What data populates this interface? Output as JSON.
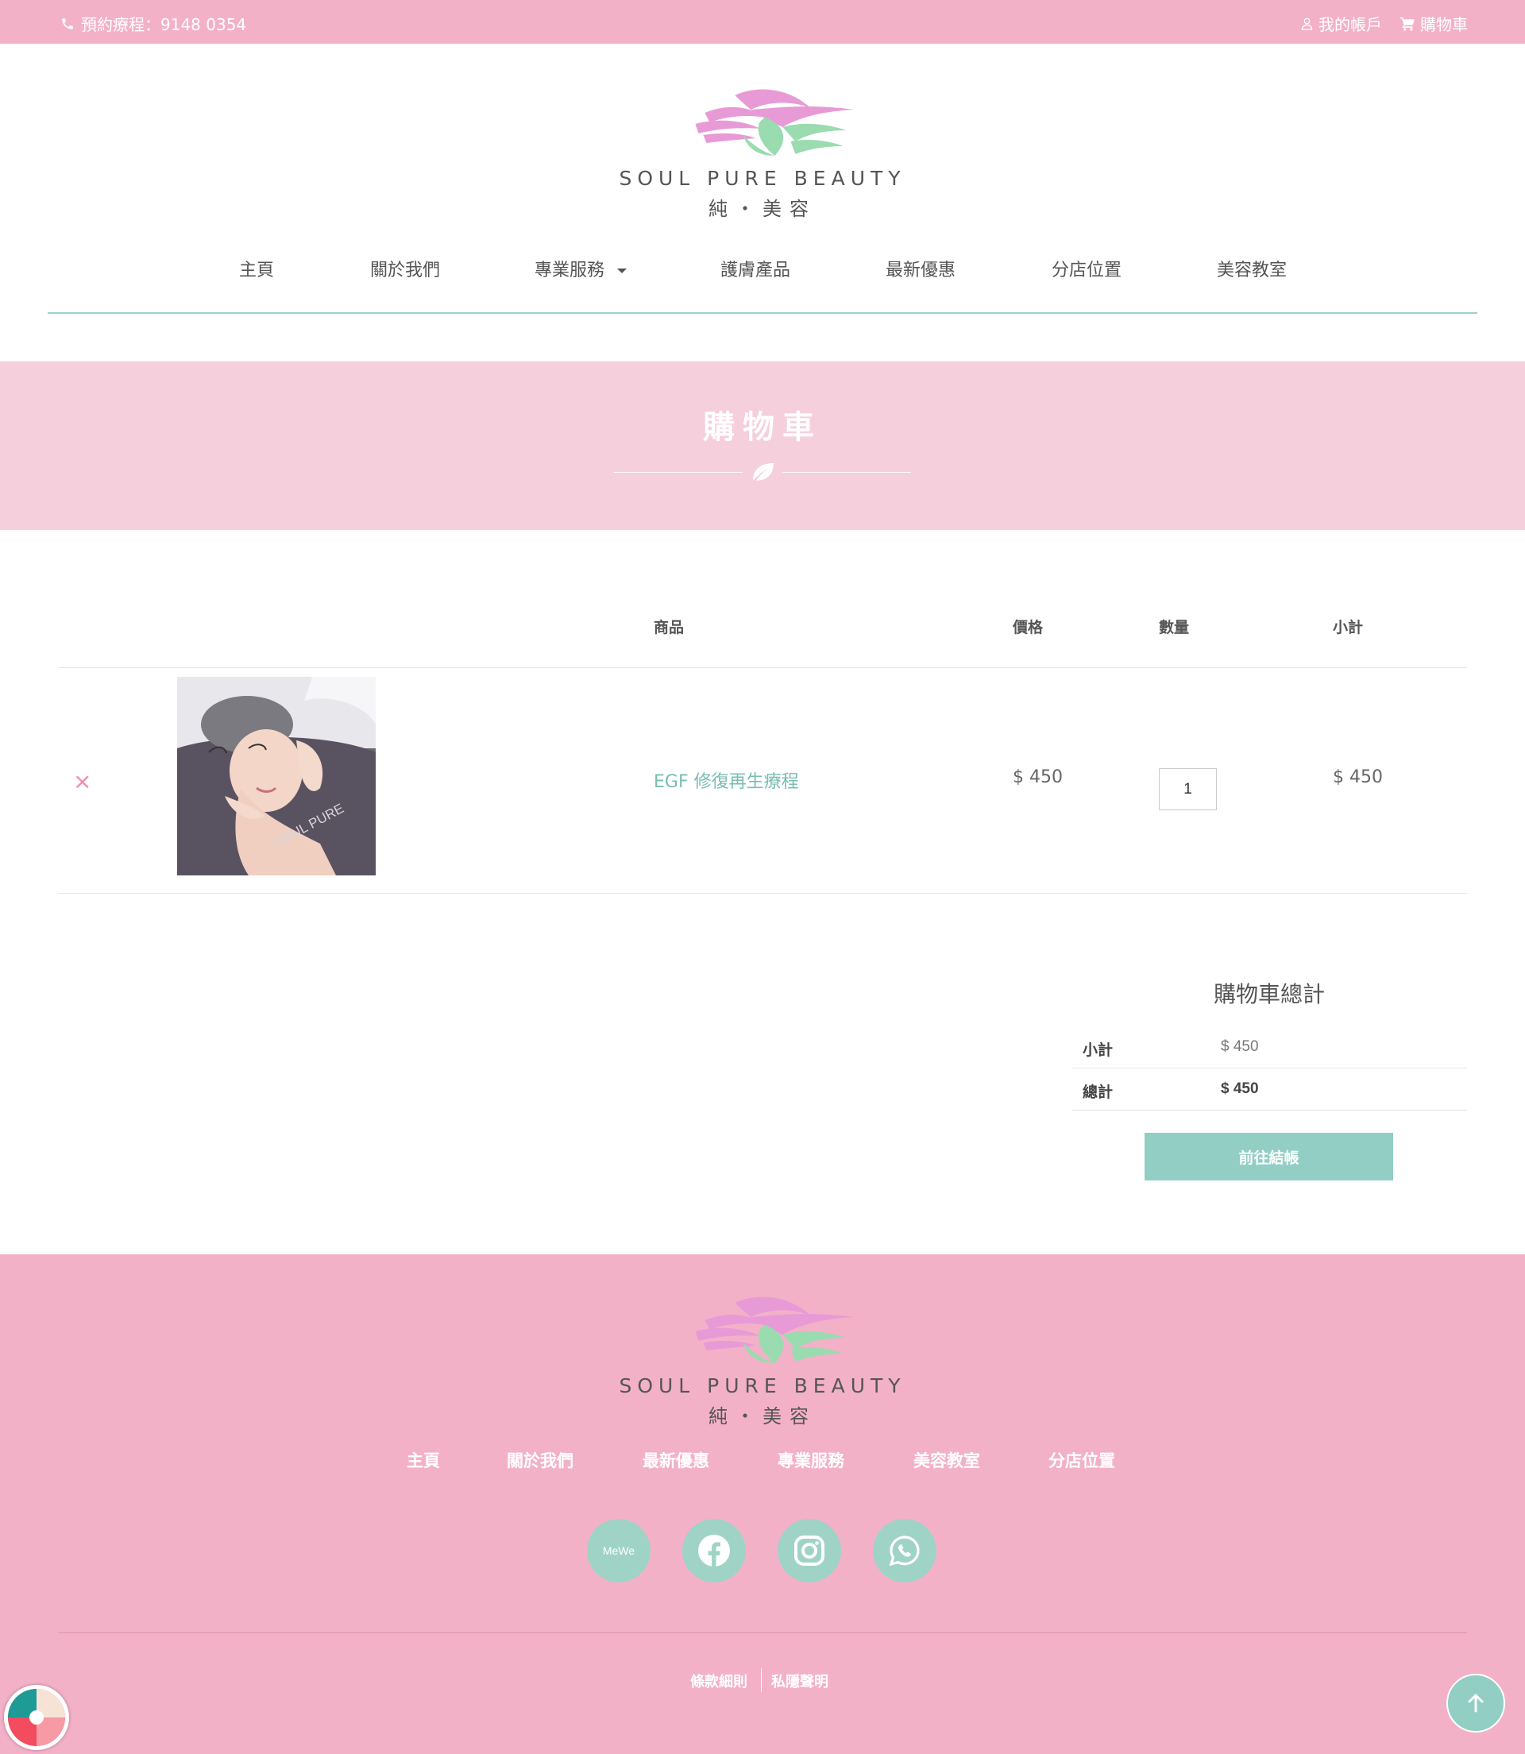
{
  "topbar": {
    "phone_text": "預約療程：9148 0354",
    "account_label": "我的帳戶",
    "cart_label": "購物車"
  },
  "logo": {
    "brand_en": "SOUL PURE BEAUTY",
    "brand_zh": "純・美容"
  },
  "nav": {
    "items": [
      "主頁",
      "關於我們",
      "專業服務",
      "護膚產品",
      "最新優惠",
      "分店位置",
      "美容教室"
    ]
  },
  "banner": {
    "title": "購物車"
  },
  "cart": {
    "headers": {
      "product": "商品",
      "price": "價格",
      "quantity": "數量",
      "subtotal": "小計"
    },
    "remove_symbol": "×",
    "items": [
      {
        "name": "EGF 修復再生療程",
        "price": "$ 450",
        "quantity": "1",
        "subtotal": "$ 450",
        "image_text": "SOUL PURE"
      }
    ]
  },
  "totals": {
    "title": "購物車總計",
    "subtotal_label": "小計",
    "subtotal_value": "$ 450",
    "total_label": "總計",
    "total_value": "$ 450",
    "checkout_label": "前往結帳"
  },
  "footer": {
    "nav": [
      "主頁",
      "關於我們",
      "最新優惠",
      "專業服務",
      "美容教室",
      "分店位置"
    ],
    "social": {
      "mewe_label": "MeWe"
    },
    "terms_label": "條款細則",
    "privacy_label": "私隱聲明"
  },
  "colors": {
    "pink": "#f3b1c8",
    "banner_pink": "#f5cfdc",
    "mint": "#92cec4",
    "link_teal": "#79bdb3"
  }
}
